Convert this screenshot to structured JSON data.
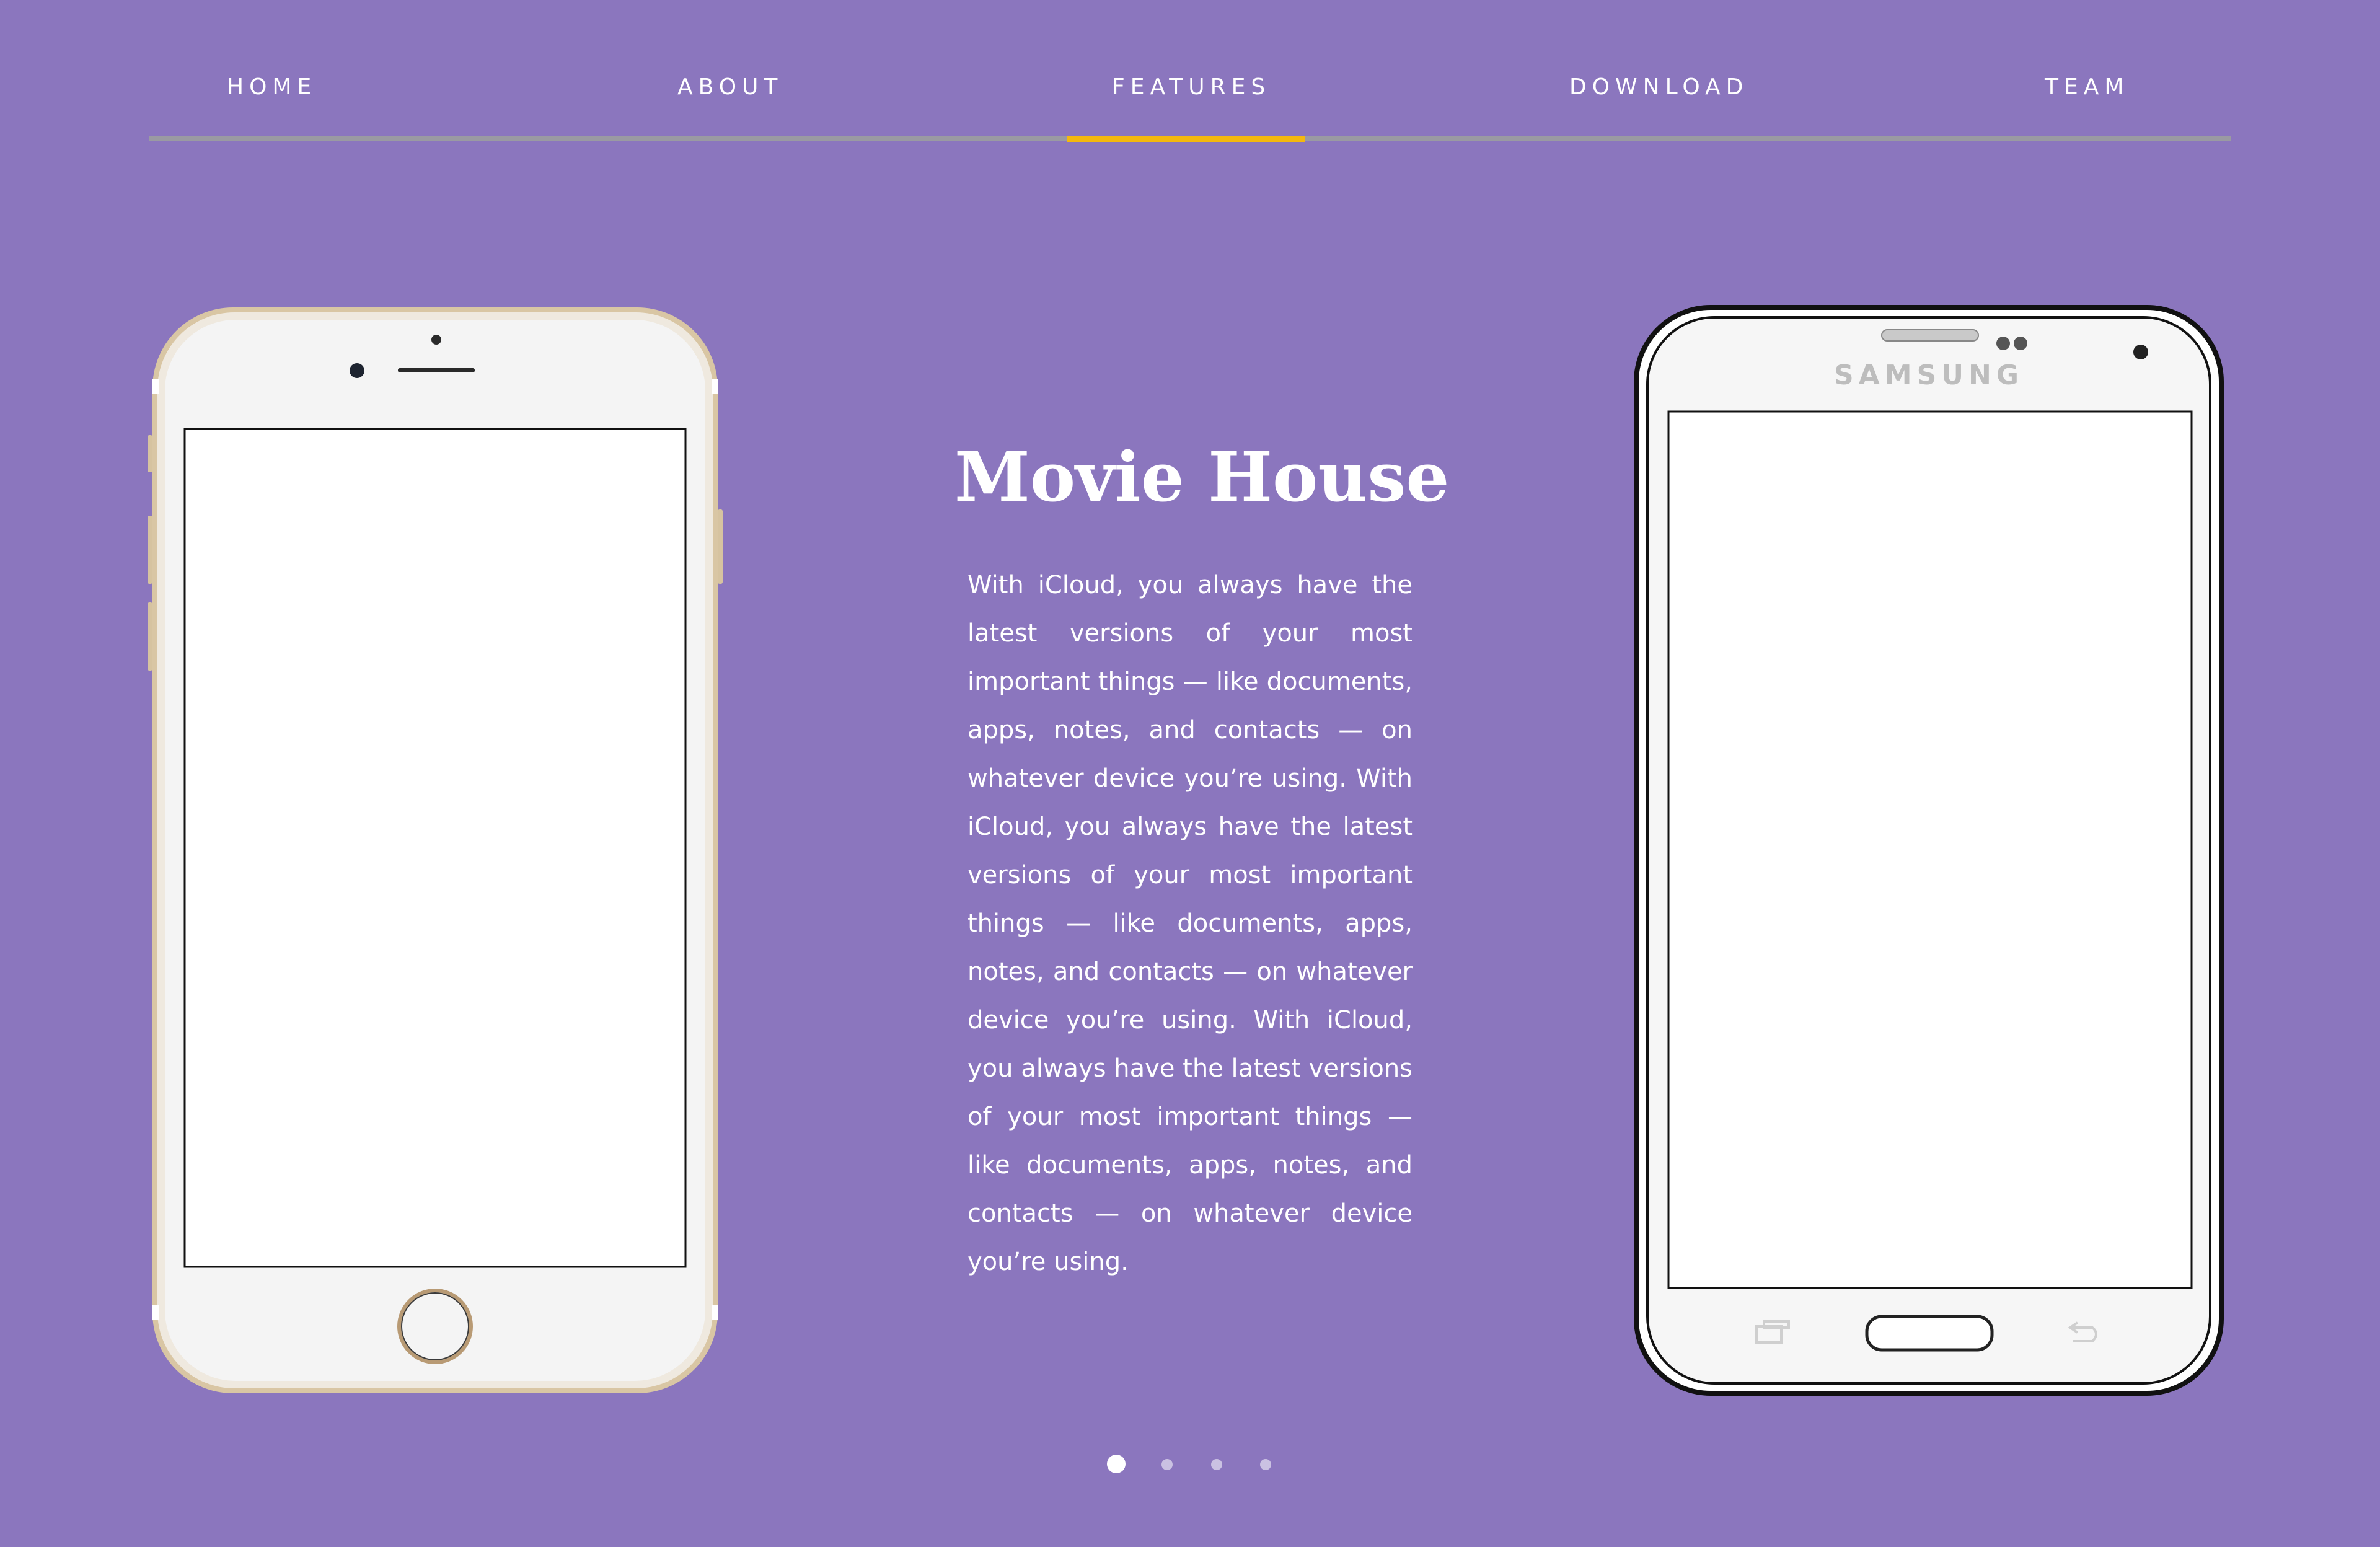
{
  "nav": {
    "items": [
      {
        "label": "HOME"
      },
      {
        "label": "ABOUT"
      },
      {
        "label": "FEATURES"
      },
      {
        "label": "DOWNLOAD"
      },
      {
        "label": "TEAM"
      }
    ],
    "active_index": 2
  },
  "main": {
    "title": "Movie House",
    "body": "With iCloud, you always have the latest versions of your most important things — like documents, apps, notes, and contacts — on whatever device you’re using. With iCloud, you always have the latest versions of your most important things — like documents, apps, notes, and contacts — on whatever device you’re using. With iCloud, you always have the latest versions of your most important things — like documents, apps, notes, and contacts — on whatever device you’re using."
  },
  "phones": {
    "right_brand": "SAMSUNG"
  },
  "pagination": {
    "count": 4,
    "active_index": 0
  },
  "colors": {
    "background": "#8b76be",
    "accent": "#f4b80f",
    "nav_line": "#9a9aa2"
  }
}
